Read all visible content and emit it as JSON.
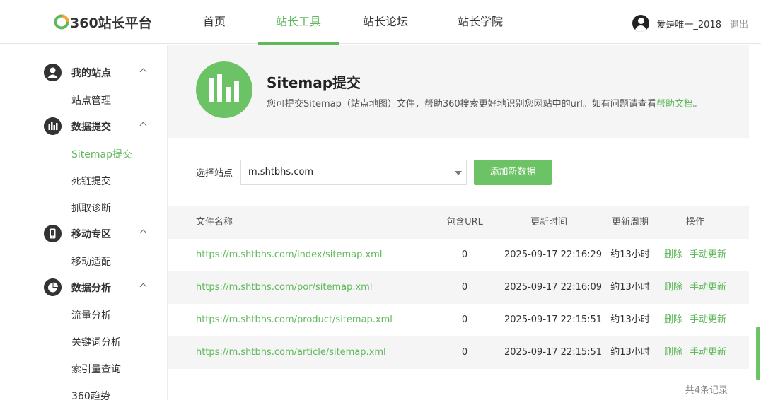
{
  "header": {
    "logo_text": "360站长平台",
    "nav": [
      "首页",
      "站长工具",
      "站长论坛",
      "站长学院"
    ],
    "active_nav": 1,
    "username": "爱是唯一_2018",
    "logout": "退出"
  },
  "sidebar": {
    "groups": [
      {
        "title": "我的站点",
        "icon": "user-icon",
        "items": [
          "站点管理"
        ]
      },
      {
        "title": "数据提交",
        "icon": "bar-chart-icon",
        "items": [
          "Sitemap提交",
          "死链提交",
          "抓取诊断"
        ]
      },
      {
        "title": "移动专区",
        "icon": "mobile-icon",
        "items": [
          "移动适配"
        ]
      },
      {
        "title": "数据分析",
        "icon": "pie-chart-icon",
        "items": [
          "流量分析",
          "关键词分析",
          "索引量查询",
          "360趋势"
        ]
      }
    ],
    "active_item": "Sitemap提交"
  },
  "banner": {
    "title": "Sitemap提交",
    "desc_before": "您可提交Sitemap（站点地图）文件，帮助360搜索更好地识别您网站中的url。如有问题请查看",
    "desc_link": "帮助文档",
    "desc_after": "。"
  },
  "site_select": {
    "label": "选择站点",
    "value": "m.shtbhs.com",
    "add_button": "添加新数据"
  },
  "table": {
    "headers": [
      "文件名称",
      "包含URL",
      "更新时间",
      "更新周期",
      "操作"
    ],
    "rows": [
      {
        "file": "https://m.shtbhs.com/index/sitemap.xml",
        "urls": "0",
        "time": "2025-09-17 22:16:29",
        "cycle": "约13小时",
        "del": "删除",
        "update": "手动更新"
      },
      {
        "file": "https://m.shtbhs.com/por/sitemap.xml",
        "urls": "0",
        "time": "2025-09-17 22:16:09",
        "cycle": "约13小时",
        "del": "删除",
        "update": "手动更新"
      },
      {
        "file": "https://m.shtbhs.com/product/sitemap.xml",
        "urls": "0",
        "time": "2025-09-17 22:15:51",
        "cycle": "约13小时",
        "del": "删除",
        "update": "手动更新"
      },
      {
        "file": "https://m.shtbhs.com/article/sitemap.xml",
        "urls": "0",
        "time": "2025-09-17 22:15:51",
        "cycle": "约13小时",
        "del": "删除",
        "update": "手动更新"
      }
    ],
    "total": "共4条记录"
  },
  "colors": {
    "accent": "#5fb85a",
    "button": "#6cc365"
  }
}
